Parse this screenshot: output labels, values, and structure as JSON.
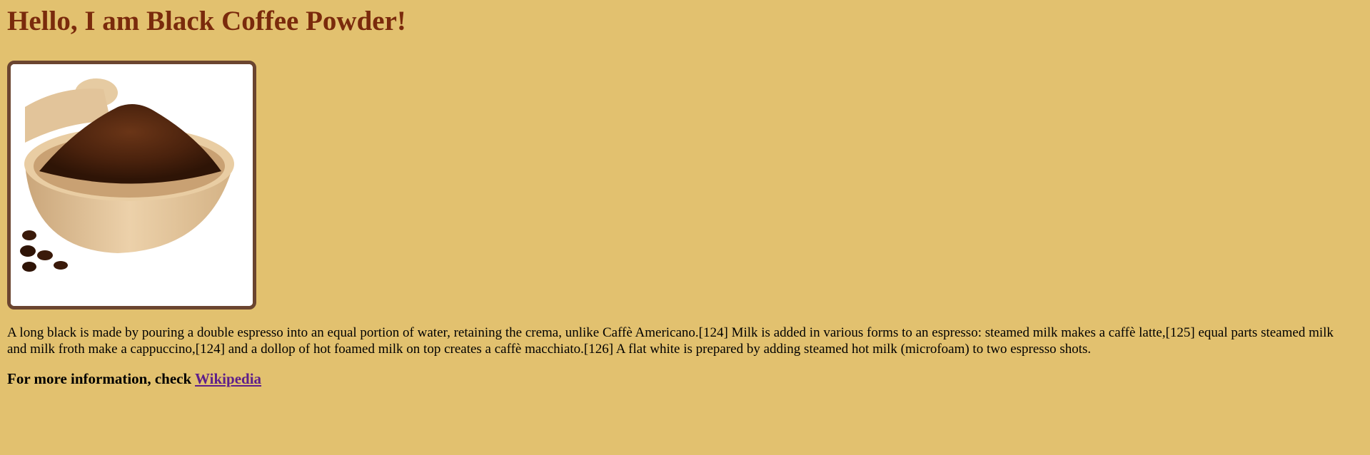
{
  "page": {
    "heading": "Hello, I am Black Coffee Powder!",
    "image_alt": "Black coffee powder in a wooden bowl",
    "paragraph": "A long black is made by pouring a double espresso into an equal portion of water, retaining the crema, unlike Caffè Americano.[124] Milk is added in various forms to an espresso: steamed milk makes a caffè latte,[125] equal parts steamed milk and milk froth make a cappuccino,[124] and a dollop of hot foamed milk on top creates a caffè macchiato.[126] A flat white is prepared by adding steamed hot milk (microfoam) to two espresso shots.",
    "more_info_prefix": "For more information, check ",
    "link_label": "Wikipedia"
  },
  "colors": {
    "background": "#e2c16f",
    "heading": "#7a2a0c",
    "image_border": "#6b4530",
    "link": "#5e1f8a"
  }
}
